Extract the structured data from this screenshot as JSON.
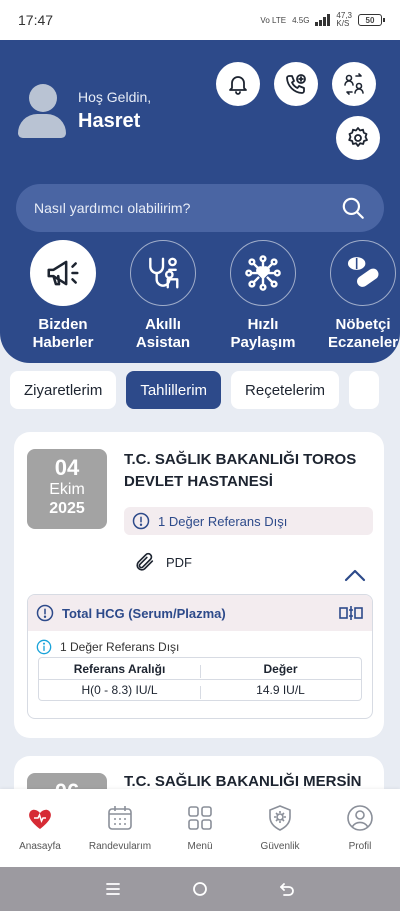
{
  "status_bar": {
    "time": "17:47",
    "network_volte": "Vo LTE",
    "network_type": "4.5G",
    "speed": "47,3",
    "speed_unit": "K/S",
    "battery": "50"
  },
  "header": {
    "greeting": "Hoş Geldin,",
    "user_name": "Hasret",
    "search_placeholder": "Nasıl yardımcı olabilirim?"
  },
  "quick_actions": [
    {
      "label": "Bizden\nHaberler",
      "icon": "megaphone-icon"
    },
    {
      "label": "Akıllı\nAsistan",
      "icon": "assistant-icon"
    },
    {
      "label": "Hızlı\nPaylaşım",
      "icon": "share-network-icon"
    },
    {
      "label": "Nöbetçi\nEczaneler",
      "icon": "pills-icon"
    }
  ],
  "tabs": [
    {
      "label": "Ziyaretlerim",
      "active": false
    },
    {
      "label": "Tahlillerim",
      "active": true
    },
    {
      "label": "Reçetelerim",
      "active": false
    }
  ],
  "cards": [
    {
      "day": "04",
      "month": "Ekim",
      "year": "2025",
      "hospital": "T.C. SAĞLIK BAKANLIĞI TOROS DEVLET HASTANESİ",
      "warning": "1 Değer Referans Dışı",
      "pdf_label": "PDF",
      "test_name": "Total HCG (Serum/Plazma)",
      "test_warning": "1 Değer Referans Dışı",
      "table_headers": [
        "Referans Aralığı",
        "Değer"
      ],
      "table_rows": [
        [
          "H(0 - 8.3) IU/L",
          "14.9 IU/L"
        ]
      ]
    },
    {
      "day": "06",
      "hospital": "T.C. SAĞLIK BAKANLIĞI MERSİN"
    }
  ],
  "bottom_nav": [
    {
      "label": "Anasayfa",
      "icon": "home-heart-icon"
    },
    {
      "label": "Randevularım",
      "icon": "calendar-icon"
    },
    {
      "label": "Menü",
      "icon": "grid-icon"
    },
    {
      "label": "Güvenlik",
      "icon": "shield-gear-icon"
    },
    {
      "label": "Profil",
      "icon": "user-circle-icon"
    }
  ],
  "colors": {
    "primary": "#2d4a8a",
    "background": "#e8ecf3",
    "warning_bg": "#f3ecef",
    "date_box": "#a3a3a3"
  }
}
